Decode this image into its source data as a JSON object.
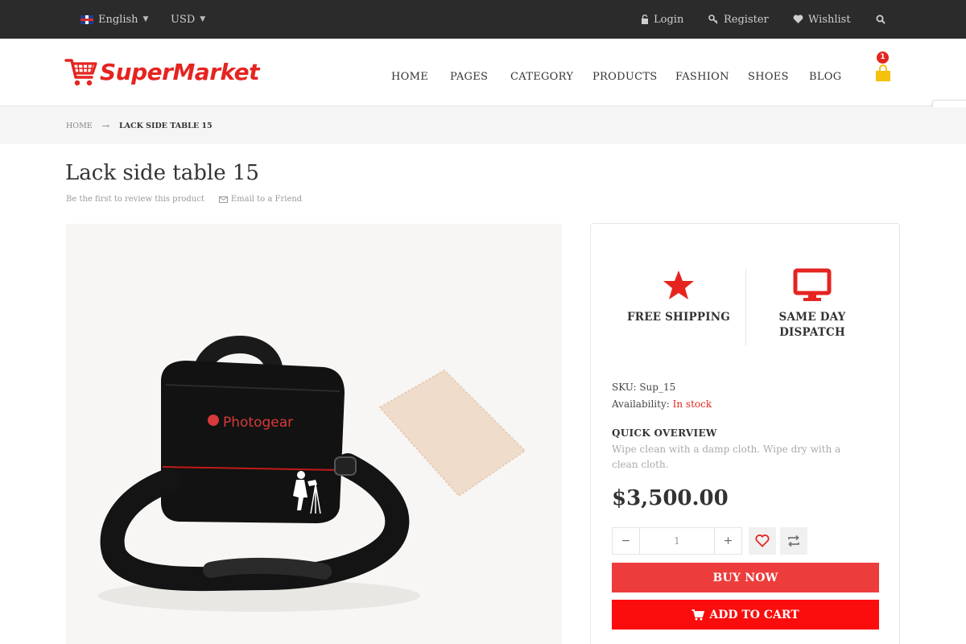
{
  "topbar": {
    "language": "English",
    "currency": "USD",
    "login": "Login",
    "register": "Register",
    "wishlist": "Wishlist"
  },
  "header": {
    "logo_text": "SuperMarket",
    "nav": [
      "HOME",
      "PAGES",
      "CATEGORY",
      "PRODUCTS",
      "FASHION",
      "SHOES",
      "BLOG"
    ],
    "cart_count": "1"
  },
  "breadcrumb": {
    "home": "HOME",
    "current": "LACK SIDE TABLE 15"
  },
  "product": {
    "title": "Lack side table 15",
    "review_link": "Be the first to review this product",
    "email_link": "Email to a Friend",
    "image_brand": "Photogear",
    "sku_label": "SKU:",
    "sku": "Sup_15",
    "availability_label": "Availability:",
    "availability": "In stock",
    "overview_title": "QUICK OVERVIEW",
    "overview_text": "Wipe clean with a damp cloth. Wipe dry with a clean cloth.",
    "price": "$3,500.00",
    "quantity": "1"
  },
  "features": {
    "shipping": "FREE SHIPPING",
    "dispatch_line1": "SAME DAY",
    "dispatch_line2": "DISPATCH"
  },
  "actions": {
    "buy_now": "BUY NOW",
    "add_to_cart": "ADD TO CART",
    "minus": "−",
    "plus": "+"
  },
  "colors": {
    "accent": "#e52420",
    "topbar": "#2b2b2b",
    "buy_now": "#ec3d3c",
    "add_to_cart": "#fb0d0d",
    "cart_icon": "#f4c20d"
  }
}
